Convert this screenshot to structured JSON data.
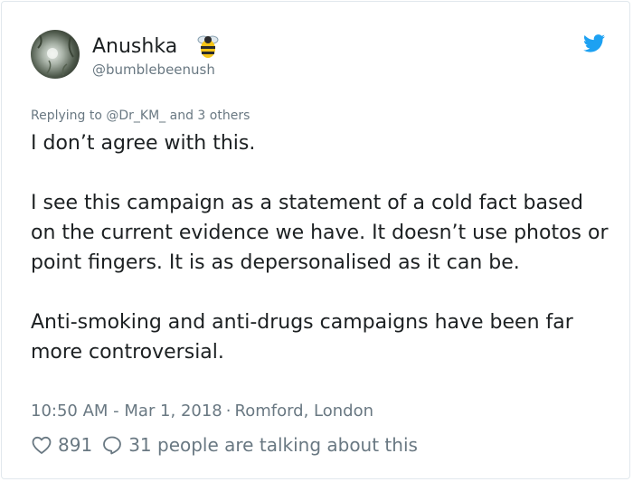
{
  "author": {
    "display_name": "Anushka",
    "handle": "@bumblebeenush",
    "name_emoji_icon": "bee-icon",
    "avatar_icon": "avatar"
  },
  "brand": {
    "icon": "twitter-bird-icon",
    "color": "#1da1f2"
  },
  "reply": {
    "prefix": "Replying to ",
    "mention": "@Dr_KM_",
    "suffix": " and 3 others"
  },
  "tweet": {
    "paragraphs": [
      "I don’t agree with this.",
      "I see this campaign as a statement of a cold fact based on the current evidence we have. It doesn’t use photos or point fingers. It is as depersonalised as it can be.",
      "Anti-smoking and anti-drugs campaigns have been far more controversial."
    ]
  },
  "meta": {
    "timestamp": "10:50 AM - Mar 1, 2018",
    "separator": "·",
    "location": "Romford, London"
  },
  "actions": {
    "like_icon": "heart-icon",
    "like_count": "891",
    "reply_icon": "comment-icon",
    "talking_text": "31 people are talking about this"
  },
  "colors": {
    "text": "#1c2022",
    "secondary_text": "#697882",
    "border": "#e1e8ed"
  }
}
